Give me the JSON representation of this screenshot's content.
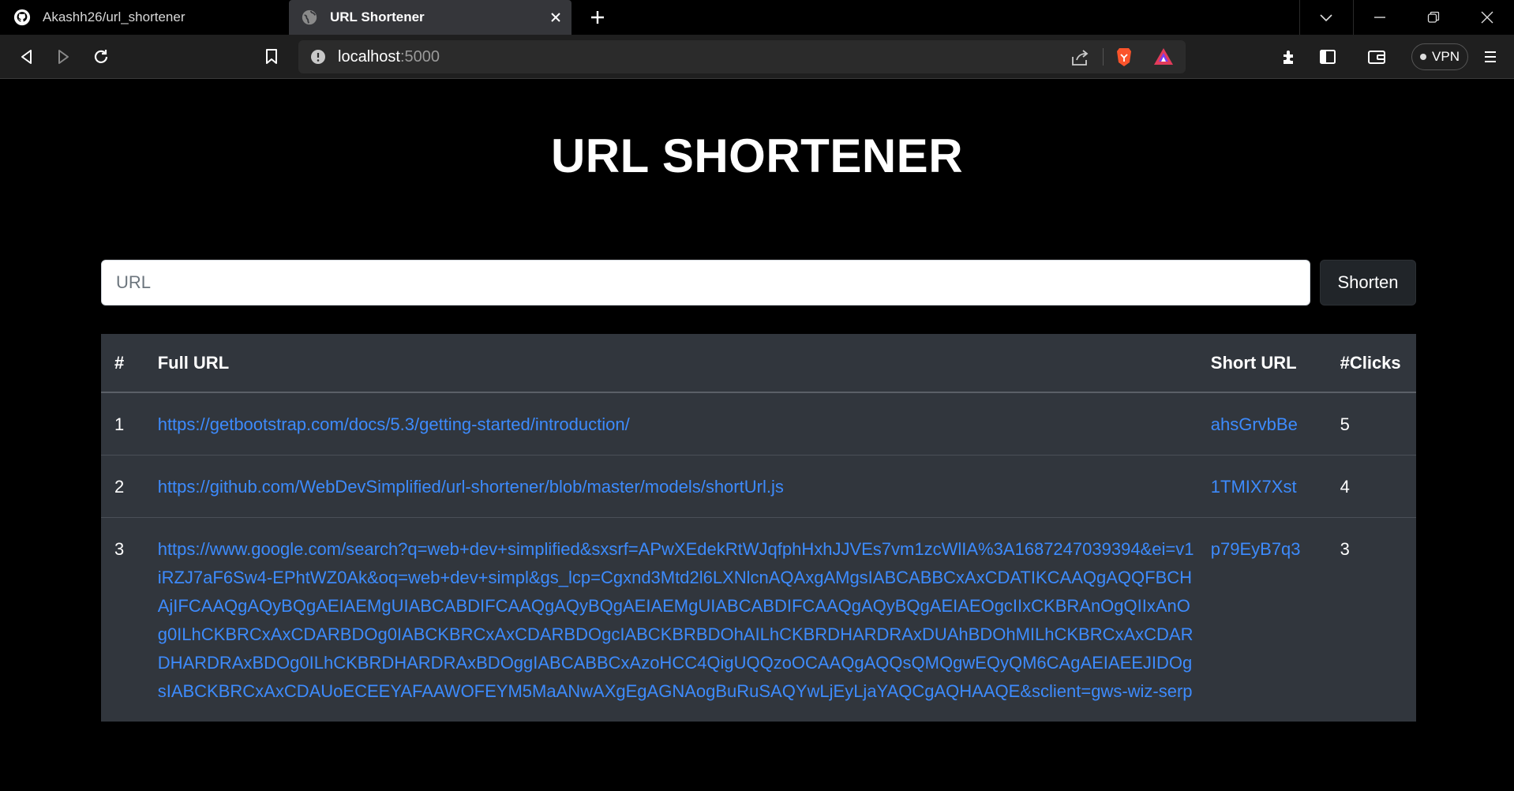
{
  "browser": {
    "tabs": [
      {
        "title": "Akashh26/url_shortener",
        "active": false,
        "icon": "github-icon"
      },
      {
        "title": "URL Shortener",
        "active": true,
        "icon": "globe-icon"
      }
    ],
    "address": {
      "host": "localhost",
      "port": ":5000"
    },
    "vpn_label": "VPN"
  },
  "page": {
    "title": "URL SHORTENER",
    "url_input": {
      "placeholder": "URL",
      "value": ""
    },
    "shorten_label": "Shorten",
    "table": {
      "headers": [
        "#",
        "Full URL",
        "Short URL",
        "#Clicks"
      ],
      "rows": [
        {
          "num": "1",
          "full": "https://getbootstrap.com/docs/5.3/getting-started/introduction/",
          "short": "ahsGrvbBe",
          "clicks": "5"
        },
        {
          "num": "2",
          "full": "https://github.com/WebDevSimplified/url-shortener/blob/master/models/shortUrl.js",
          "short": "1TMIX7Xst",
          "clicks": "4"
        },
        {
          "num": "3",
          "full": "https://www.google.com/search?q=web+dev+simplified&sxsrf=APwXEdekRtWJqfphHxhJJVEs7vm1zcWlIA%3A1687247039394&ei=v1iRZJ7aF6Sw4-EPhtWZ0Ak&oq=web+dev+simpl&gs_lcp=Cgxnd3Mtd2l6LXNlcnAQAxgAMgsIABCABBCxAxCDATIKCAAQgAQQFBCHAjIFCAAQgAQyBQgAEIAEMgUIABCABDIFCAAQgAQyBQgAEIAEMgUIABCABDIFCAAQgAQyBQgAEIAEOgcIIxCKBRAnOgQIIxAnOg0ILhCKBRCxAxCDARBDOg0IABCKBRCxAxCDARBDOgcIABCKBRBDOhAILhCKBRDHARDRAxDUAhBDOhMILhCKBRCxAxCDARDHARDRAxBDOg0ILhCKBRDHARDRAxBDOggIABCABBCxAzoHCC4QigUQQzoOCAAQgAQQsQMQgwEQyQM6CAgAEIAEEJIDOgsIABCKBRCxAxCDAUoECEEYAFAAWOFEYM5MaANwAXgEgAGNAogBuRuSAQYwLjEyLjaYAQCgAQHAAQE&sclient=gws-wiz-serp",
          "short": "p79EyB7q3",
          "clicks": "3"
        }
      ]
    }
  },
  "colors": {
    "link": "#3d8bfd",
    "table_bg": "#31363d",
    "page_bg": "#000000"
  }
}
